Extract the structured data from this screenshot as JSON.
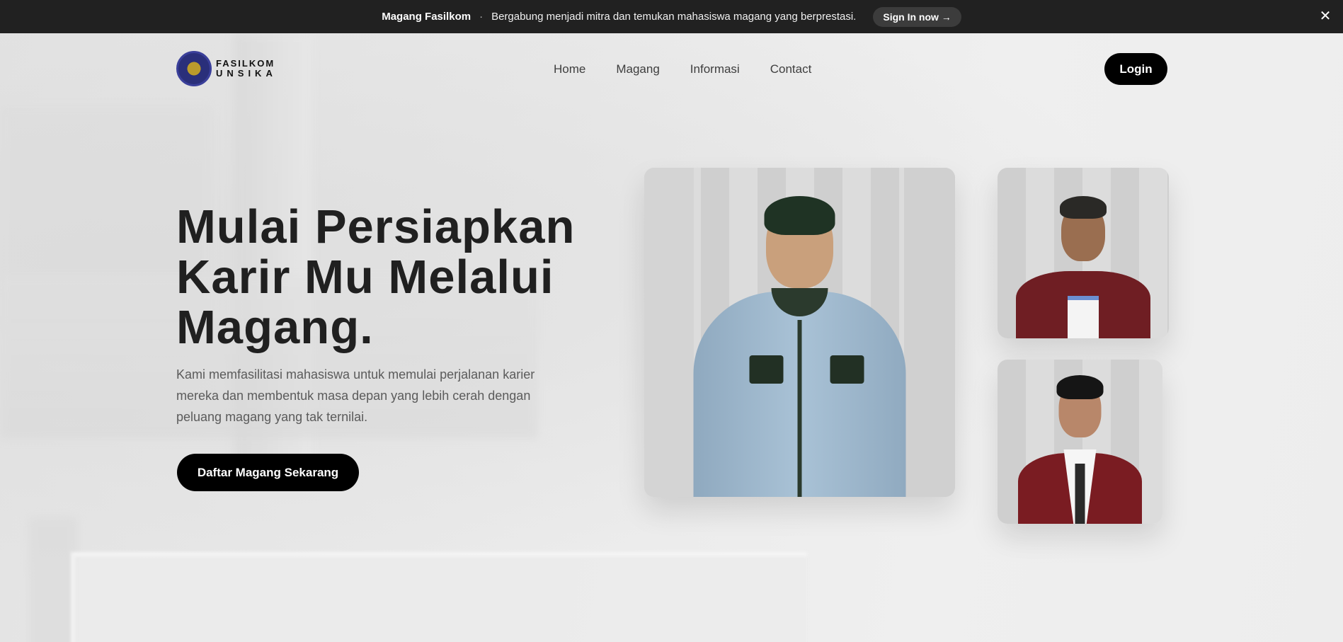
{
  "announcement": {
    "brand": "Magang Fasilkom",
    "separator": "·",
    "message": "Bergabung menjadi mitra dan temukan mahasiswa magang yang berprestasi.",
    "signin_label": "Sign In now →",
    "close_glyph": "✕"
  },
  "logo": {
    "line1": "FASILKOM",
    "line2": "UNSIKA"
  },
  "nav": {
    "items": [
      {
        "label": "Home"
      },
      {
        "label": "Magang"
      },
      {
        "label": "Informasi"
      },
      {
        "label": "Contact"
      }
    ],
    "login_label": "Login"
  },
  "hero": {
    "title_lines": [
      "Mulai Persiapkan",
      "Karir Mu Melalui",
      "Magang."
    ],
    "description": "Kami memfasilitasi mahasiswa untuk memulai perjalanan karier mereka dan membentuk masa depan yang lebih cerah dengan peluang magang yang tak ternilai.",
    "cta_label": "Daftar Magang Sekarang"
  },
  "colors": {
    "announcement_bg": "#212121",
    "button_bg": "#000000",
    "page_bg": "#e6e6e6"
  }
}
